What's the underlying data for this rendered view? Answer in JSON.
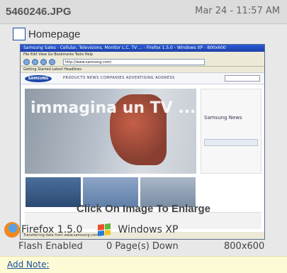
{
  "header": {
    "filename": "5460246.JPG",
    "date": "Mar 24 - 11:57 AM"
  },
  "checkbox": {
    "label": "Homepage",
    "checked": false
  },
  "thumbnail": {
    "window_title": "Samsung Sales - Cellular, Televisions, Monitor L.C. TV ... - Firefox 1.5.0 - Windows XP - 800x600",
    "menu": "File  Edit  View  Go  Bookmarks  Tools  Help",
    "url": "http://www.samsung.com/",
    "bookmarks": "Getting Started   Latest Headlines",
    "site_logo": "SAMSUNG",
    "site_nav": "PRODUCTS   NEWS   COMPANIES   ADVERTISING   ADDRESS",
    "hero_text": "immagina un TV ...",
    "side_title": "Samsung News",
    "status": "Transferring data from www.samsung.com..."
  },
  "enlarge_text": "Click On Image To Enlarge",
  "specs": {
    "browser": "Firefox 1.5.0",
    "os": "Windows XP",
    "browser_icon": "firefox-icon",
    "os_icon": "windows-icon"
  },
  "info": {
    "flash": "Flash Enabled",
    "pages": "0 Page(s) Down",
    "resolution": "800x600"
  },
  "note": {
    "link": "Add Note:"
  }
}
